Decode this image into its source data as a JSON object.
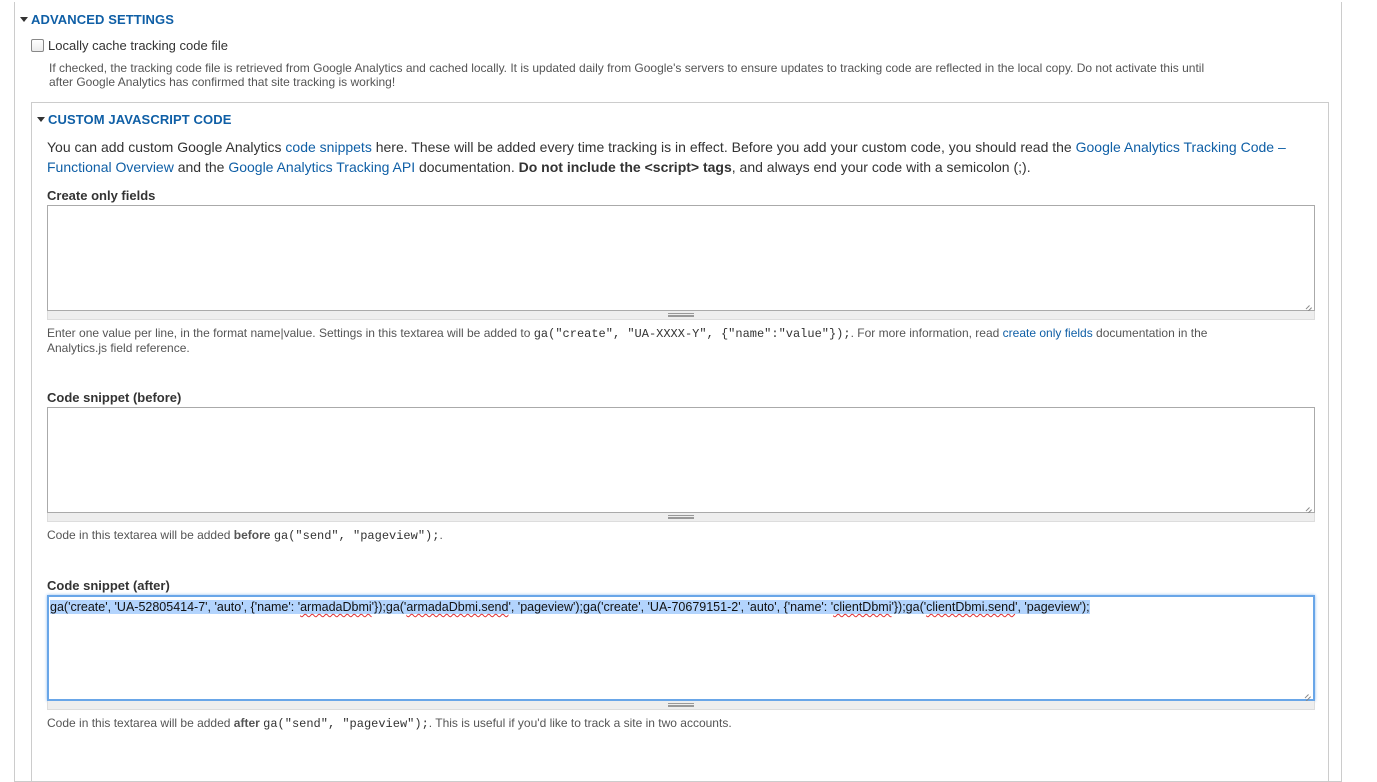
{
  "advanced": {
    "legend": "ADVANCED SETTINGS",
    "cache_checkbox_label": "Locally cache tracking code file",
    "cache_description_line1": "If checked, the tracking code file is retrieved from Google Analytics and cached locally. It is updated daily from Google's servers to ensure updates to tracking code are reflected in the local copy. Do not activate this until",
    "cache_description_line2": "after Google Analytics has confirmed that site tracking is working!"
  },
  "custom_js": {
    "legend": "CUSTOM JAVASCRIPT CODE",
    "intro": {
      "part1": "You can add custom Google Analytics ",
      "link_snippets": "code snippets",
      "part2": " here. These will be added every time tracking is in effect. Before you add your custom code, you should read the ",
      "link_overview": "Google Analytics Tracking Code – Functional Overview",
      "part3": " and the ",
      "link_api": "Google Analytics Tracking API",
      "part4": " documentation. ",
      "bold": "Do not include the <script> tags",
      "part5": ", and always end your code with a semicolon (;)."
    },
    "create_only": {
      "label": "Create only fields",
      "value": "",
      "help_part1": "Enter one value per line, in the format name|value. Settings in this textarea will be added to ",
      "help_code": "ga(\"create\", \"UA-XXXX-Y\", {\"name\":\"value\"});",
      "help_part2": ". For more information, read ",
      "help_link": "create only fields",
      "help_part3": " documentation in the",
      "help_part4": "Analytics.js field reference."
    },
    "before": {
      "label": "Code snippet (before)",
      "value": "",
      "help_part1": "Code in this textarea will be added ",
      "help_bold": "before",
      "help_code": "ga(\"send\", \"pageview\");",
      "help_part2": "."
    },
    "after": {
      "label": "Code snippet (after)",
      "value_segments": [
        "ga('create', 'UA-52805414-7', 'auto', {'name': '",
        "armadaDbmi",
        "'});ga('",
        "armadaDbmi.send",
        "', 'pageview');ga('create', 'UA-70679151-2', 'auto', {'name': '",
        "clientDbmi",
        "'});ga('",
        "clientDbmi.send",
        "', 'pageview');"
      ],
      "help_part1": "Code in this textarea will be added ",
      "help_bold": "after",
      "help_code": "ga(\"send\", \"pageview\");",
      "help_part2": ". This is useful if you'd like to track a site in two accounts."
    }
  }
}
